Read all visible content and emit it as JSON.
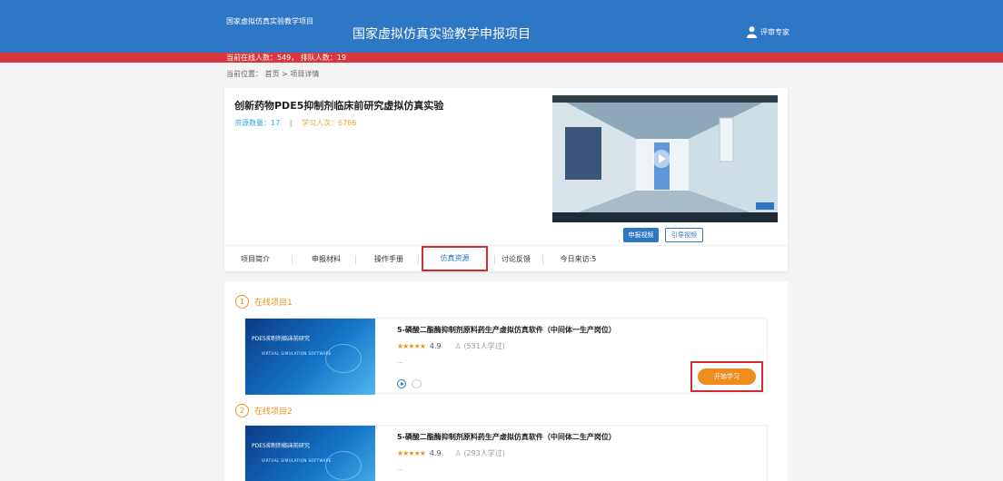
{
  "header": {
    "small_title": "国家虚拟仿真实验教学项目",
    "title": "国家虚拟仿真实验教学申报项目",
    "user_label": "评审专家"
  },
  "status": {
    "online_text": "当前在线人数：549，  排队人数：19"
  },
  "breadcrumb": "当前位置： 首页  > 项目详情",
  "project": {
    "title": "创新药物PDE5抑制剂临床前研究虚拟仿真实验",
    "resource_count": "资源数量：17",
    "learning_count": "学习人次：6766",
    "buttons": {
      "declare_video": "申报视频",
      "guide_video": "引导视频"
    }
  },
  "tabs": [
    {
      "label": "项目简介"
    },
    {
      "label": "申报材料"
    },
    {
      "label": "操作手册"
    },
    {
      "label": "仿真资源"
    },
    {
      "label": "讨论反馈"
    },
    {
      "label": "今日来访:5"
    }
  ],
  "online_projects": [
    {
      "heading": "在线项目1",
      "number": "1",
      "title": "5-磷酸二酯酶抑制剂原料药生产虚拟仿真软件（中间体一生产岗位）",
      "rating": "4.9",
      "learners": "(531人学过)",
      "ellipsis": "...",
      "thumb_title": "PDE5抑制剂临床前研究",
      "thumb_sub": "VIRTUAL SIMULATION SOFTWARE",
      "start_label": "开始学习"
    },
    {
      "heading": "在线项目2",
      "number": "2",
      "title": "5-磷酸二酯酶抑制剂原料药生产虚拟仿真软件（中间体二生产岗位）",
      "rating": "4.9",
      "learners": "(293人学过)",
      "ellipsis": "...",
      "thumb_title": "PDE5抑制剂临床前研究",
      "thumb_sub": "VIRTUAL SIMULATION SOFTWARE"
    }
  ],
  "colors": {
    "brand_blue": "#2d77c4",
    "red_bar": "#d8383d",
    "orange": "#ef8c1e"
  },
  "icons": {
    "user": "user-icon",
    "play": "play-icon",
    "chat": "chat-icon"
  }
}
